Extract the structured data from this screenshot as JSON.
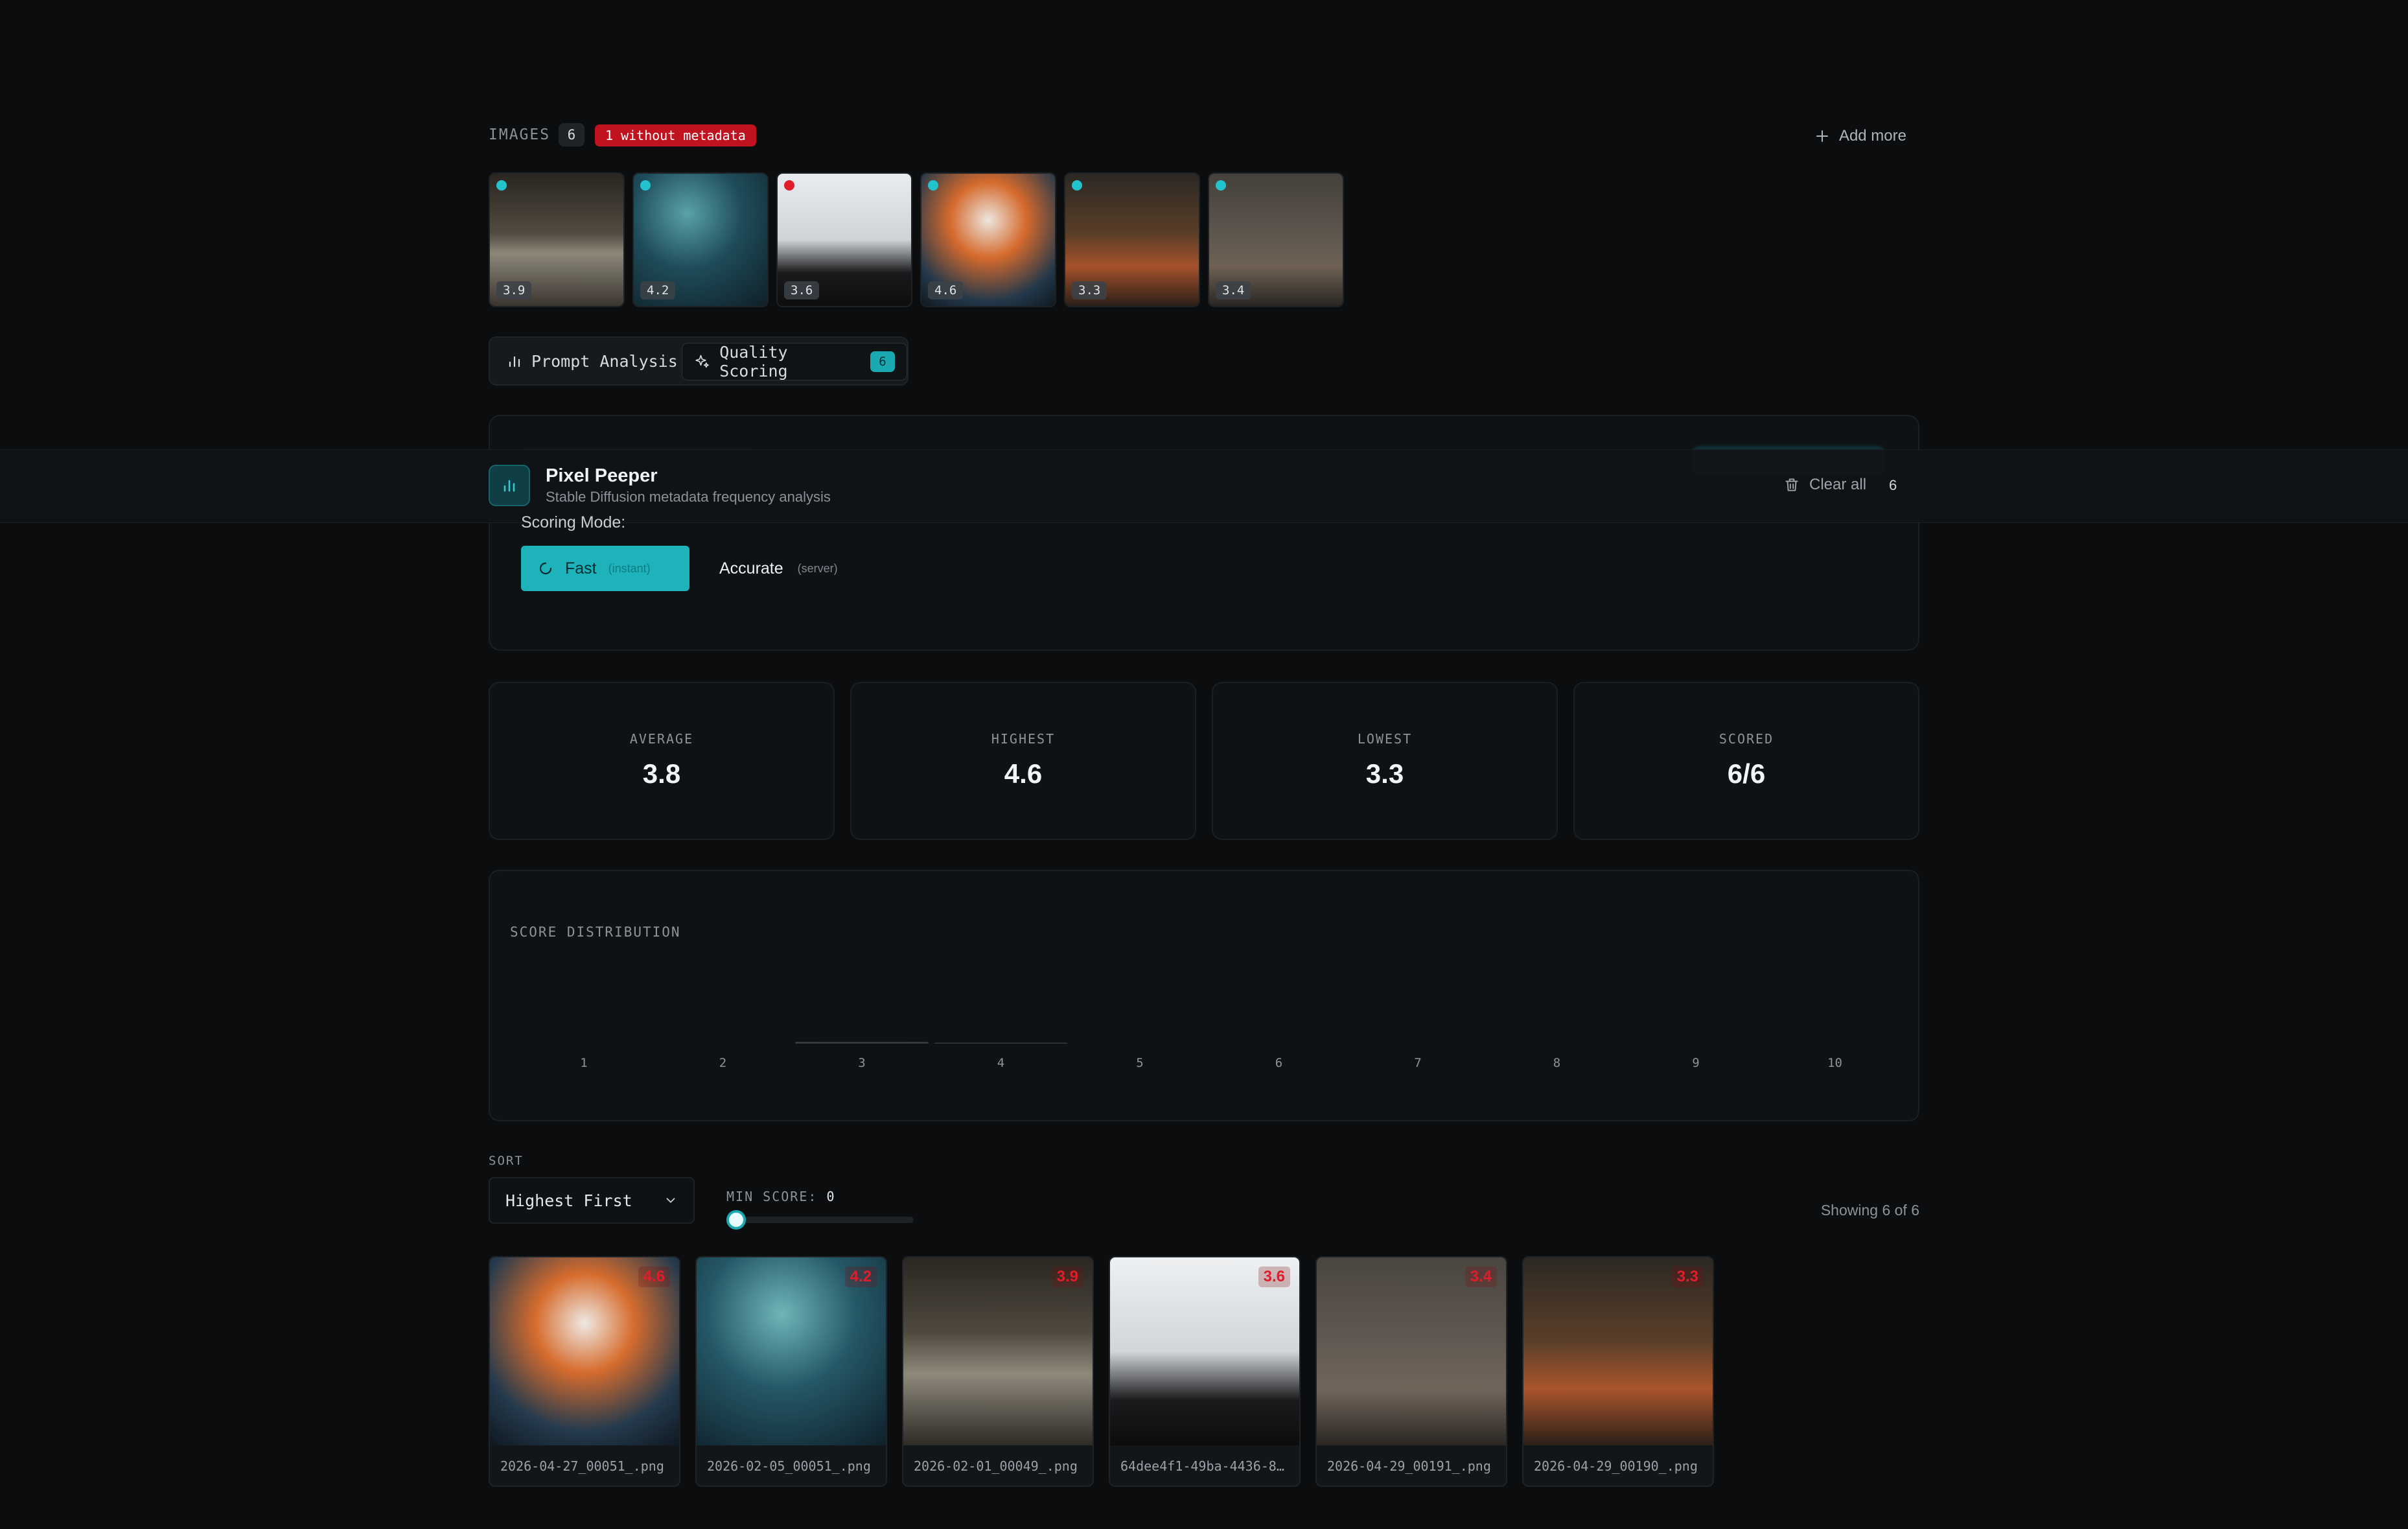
{
  "images_section": {
    "label": "IMAGES",
    "count": "6",
    "warning": "1 without metadata",
    "add_more": "Add more",
    "thumbs": [
      {
        "score": "3.9",
        "dot": "#22c3cc",
        "bg": "linear-gradient(180deg,#2a2620 0%,#514b40 45%,#8d877a 60%,#3a352f 100%)"
      },
      {
        "score": "4.2",
        "dot": "#22c3cc",
        "bg": "radial-gradient(circle at 40% 30%,#5aa2a6 0%,#1e4c59 45%,#0f1f27 100%)"
      },
      {
        "score": "3.6",
        "dot": "#e11d2a",
        "bg": "linear-gradient(180deg,#e9ecef 0%,#cfd3d6 50%,#1a1a1c 75%,#0d0d0e 100%)"
      },
      {
        "score": "4.6",
        "dot": "#22c3cc",
        "bg": "radial-gradient(circle at 50% 35%,#ece6df 0%,#d56a2d 35%,#22384a 75%,#101820 100%)"
      },
      {
        "score": "3.3",
        "dot": "#22c3cc",
        "bg": "linear-gradient(180deg,#2c2824 0%,#5a3e28 45%,#a4512a 70%,#2b1f18 100%)"
      },
      {
        "score": "3.4",
        "dot": "#22c3cc",
        "bg": "linear-gradient(180deg,#45403b 0%,#5b544c 40%,#6e6154 70%,#2a2622 100%)"
      }
    ]
  },
  "tabs": [
    {
      "label": "Prompt Analysis",
      "icon": "bar-chart-icon"
    },
    {
      "label": "Quality Scoring",
      "icon": "sparkle-icon",
      "count": "6"
    }
  ],
  "header": {
    "app_name": "Pixel Peeper",
    "subtitle": "Stable Diffusion metadata frequency analysis",
    "clear_all": "Clear all",
    "count": "6"
  },
  "scoring": {
    "mode_label": "Scoring Mode:",
    "fast_label": "Fast",
    "fast_hint": "(instant)",
    "accurate_label": "Accurate",
    "accurate_hint": "(server)"
  },
  "stats": [
    {
      "label": "AVERAGE",
      "value": "3.8"
    },
    {
      "label": "HIGHEST",
      "value": "4.6"
    },
    {
      "label": "LOWEST",
      "value": "3.3"
    },
    {
      "label": "SCORED",
      "value": "6/6"
    }
  ],
  "chart_data": {
    "type": "bar",
    "title": "SCORE DISTRIBUTION",
    "categories": [
      "1",
      "2",
      "3",
      "4",
      "5",
      "6",
      "7",
      "8",
      "9",
      "10"
    ],
    "values": [
      0,
      0,
      4,
      2,
      0,
      0,
      0,
      0,
      0,
      0
    ],
    "ylim": [
      0,
      200
    ]
  },
  "sort": {
    "label": "SORT",
    "selected": "Highest First",
    "min_score_label": "MIN SCORE:",
    "min_score_value": "0",
    "showing": "Showing 6 of 6"
  },
  "results": [
    {
      "score": "4.6",
      "filename": "2026-04-27_00051_.png",
      "bg": "radial-gradient(circle at 50% 35%,#efe9e3 0%,#d66c2e 32%,#243a4d 70%,#0f1820 100%)"
    },
    {
      "score": "4.2",
      "filename": "2026-02-05_00051_.png",
      "bg": "radial-gradient(circle at 45% 30%,#6fb5b8 0%,#245766 45%,#0f202a 100%)"
    },
    {
      "score": "3.9",
      "filename": "2026-02-01_00049_.png",
      "bg": "linear-gradient(180deg,#2b2721 0%,#4f493f 40%,#8f897c 62%,#2e2a25 100%)"
    },
    {
      "score": "3.6",
      "filename": "64dee4f1-49ba-4436-8…",
      "bg": "linear-gradient(180deg,#eef0f2 0%,#d2d6d9 50%,#1b1b1d 76%,#0c0c0d 100%)"
    },
    {
      "score": "3.4",
      "filename": "2026-04-29_00191_.png",
      "bg": "linear-gradient(180deg,#4a453f 0%,#5e5750 40%,#71655a 70%,#2b2724 100%)"
    },
    {
      "score": "3.3",
      "filename": "2026-04-29_00190_.png",
      "bg": "linear-gradient(180deg,#2c2823 0%,#5b3f29 45%,#a9542c 70%,#2b2018 100%)"
    }
  ]
}
